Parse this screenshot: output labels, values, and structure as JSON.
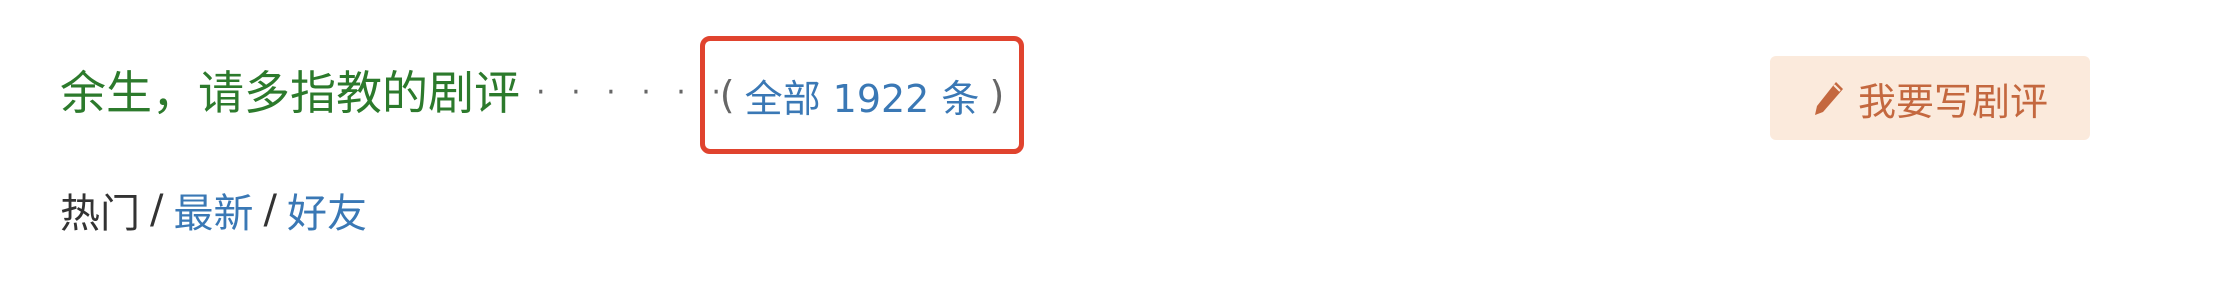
{
  "header": {
    "title": "余生，请多指教的剧评",
    "dots": "· · · · · ·",
    "total": {
      "open_paren": "(",
      "label": "全部 1922 条",
      "close_paren": ")"
    }
  },
  "actions": {
    "write_review_label": "我要写剧评",
    "write_review_icon": "pencil-icon"
  },
  "sort": {
    "items": [
      {
        "label": "热门",
        "active": true
      },
      {
        "label": "最新",
        "active": false
      },
      {
        "label": "好友",
        "active": false
      }
    ],
    "separator": "/"
  },
  "colors": {
    "title": "#2c7a2c",
    "link": "#3a78b5",
    "highlight_border": "#e0432e",
    "button_bg": "#fbeadc",
    "button_text": "#c4683f"
  }
}
